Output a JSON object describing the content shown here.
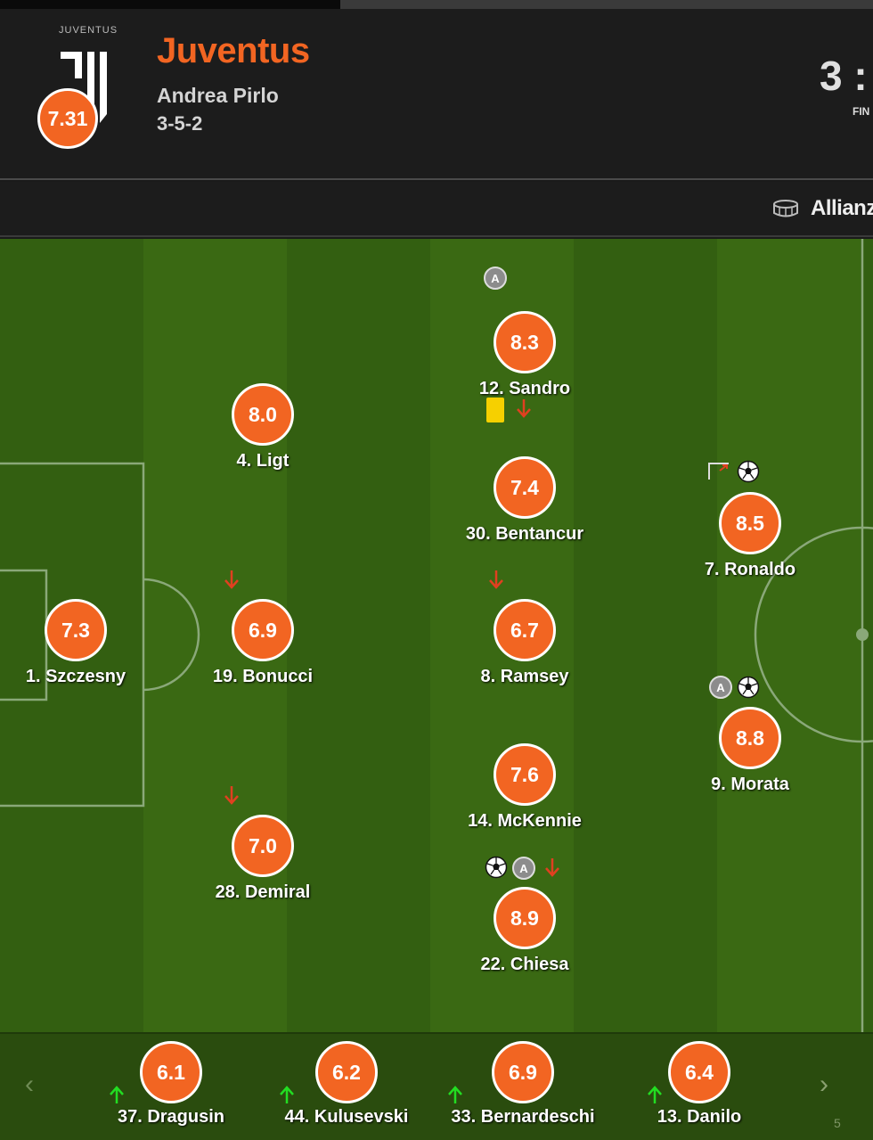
{
  "header": {
    "crest_text": "JUVENTUS",
    "team_rating": "7.31",
    "team_name": "Juventus",
    "manager": "Andrea Pirlo",
    "formation": "3-5-2",
    "score": "3 :",
    "status": "FIN"
  },
  "venue": {
    "name": "Allianz",
    "icon": "stadium-icon"
  },
  "progress_fraction": 0.39,
  "colors": {
    "rating": "#f26522",
    "team_name": "#f26522",
    "pitch_dark": "#335f11",
    "pitch_light": "#3a6913",
    "yellow_card": "#f6d000",
    "sub_in_arrow": "#22dd22",
    "sub_out_arrow": "#e04020"
  },
  "players": [
    {
      "number_name": "1. Szczesny",
      "rating": "7.3",
      "badges": []
    },
    {
      "number_name": "4. Ligt",
      "rating": "8.0",
      "badges": []
    },
    {
      "number_name": "19. Bonucci",
      "rating": "6.9",
      "badges": [
        "sub-off"
      ]
    },
    {
      "number_name": "28. Demiral",
      "rating": "7.0",
      "badges": [
        "sub-off"
      ]
    },
    {
      "number_name": "12. Sandro",
      "rating": "8.3",
      "badges": [
        "assist"
      ]
    },
    {
      "number_name": "30. Bentancur",
      "rating": "7.4",
      "badges": [
        "yellow-card",
        "sub-off"
      ]
    },
    {
      "number_name": "8. Ramsey",
      "rating": "6.7",
      "badges": [
        "sub-off"
      ]
    },
    {
      "number_name": "14. McKennie",
      "rating": "7.6",
      "badges": []
    },
    {
      "number_name": "22. Chiesa",
      "rating": "8.9",
      "badges": [
        "goal",
        "assist",
        "sub-off"
      ]
    },
    {
      "number_name": "7. Ronaldo",
      "rating": "8.5",
      "badges": [
        "header-goal",
        "goal"
      ]
    },
    {
      "number_name": "9. Morata",
      "rating": "8.8",
      "badges": [
        "assist",
        "goal"
      ]
    }
  ],
  "bench": [
    {
      "number_name": "37. Dragusin",
      "rating": "6.1",
      "badges": [
        "sub-on"
      ]
    },
    {
      "number_name": "44. Kulusevski",
      "rating": "6.2",
      "badges": [
        "sub-on"
      ]
    },
    {
      "number_name": "33. Bernardeschi",
      "rating": "6.9",
      "badges": [
        "sub-on"
      ]
    },
    {
      "number_name": "13. Danilo",
      "rating": "6.4",
      "badges": [
        "sub-on"
      ]
    }
  ],
  "bench_nav": {
    "prev": "‹",
    "next": "›",
    "page": "5"
  },
  "assist_label": "A"
}
